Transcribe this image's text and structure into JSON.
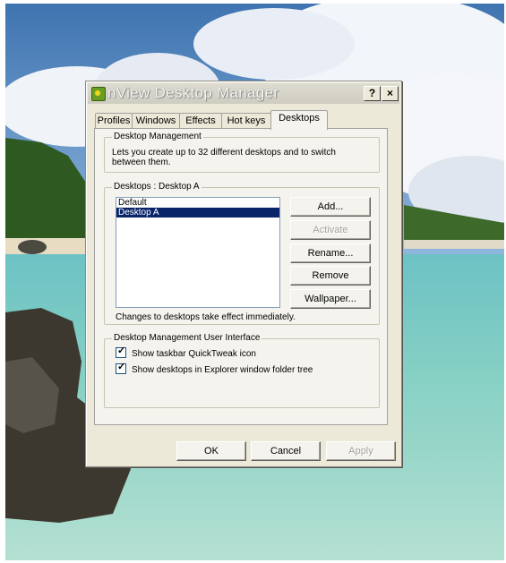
{
  "window": {
    "title": "nView Desktop Manager",
    "help_label": "?",
    "close_label": "×"
  },
  "tabs": [
    {
      "label": "Profiles"
    },
    {
      "label": "Windows"
    },
    {
      "label": "Effects"
    },
    {
      "label": "Hot keys"
    },
    {
      "label": "Desktops"
    }
  ],
  "active_tab": "Desktops",
  "desktop_management": {
    "legend": "Desktop Management",
    "description_line1": "Lets you create up to 32 different desktops and to switch",
    "description_line2": "between them."
  },
  "desktops": {
    "legend": "Desktops : Desktop A",
    "items": [
      "Default",
      "Desktop A"
    ],
    "selected": "Desktop A",
    "buttons": {
      "add": "Add...",
      "activate": "Activate",
      "rename": "Rename...",
      "remove": "Remove",
      "wallpaper": "Wallpaper..."
    },
    "note": "Changes to desktops take effect immediately."
  },
  "ui_group": {
    "legend": "Desktop Management User Interface",
    "options": [
      {
        "label": "Show taskbar QuickTweak icon",
        "checked": true
      },
      {
        "label": "Show desktops in Explorer window folder tree",
        "checked": true
      }
    ]
  },
  "footer": {
    "ok": "OK",
    "cancel": "Cancel",
    "apply": "Apply"
  },
  "colors": {
    "selection": "#0a246a",
    "dialog_face": "#ece9d8"
  }
}
